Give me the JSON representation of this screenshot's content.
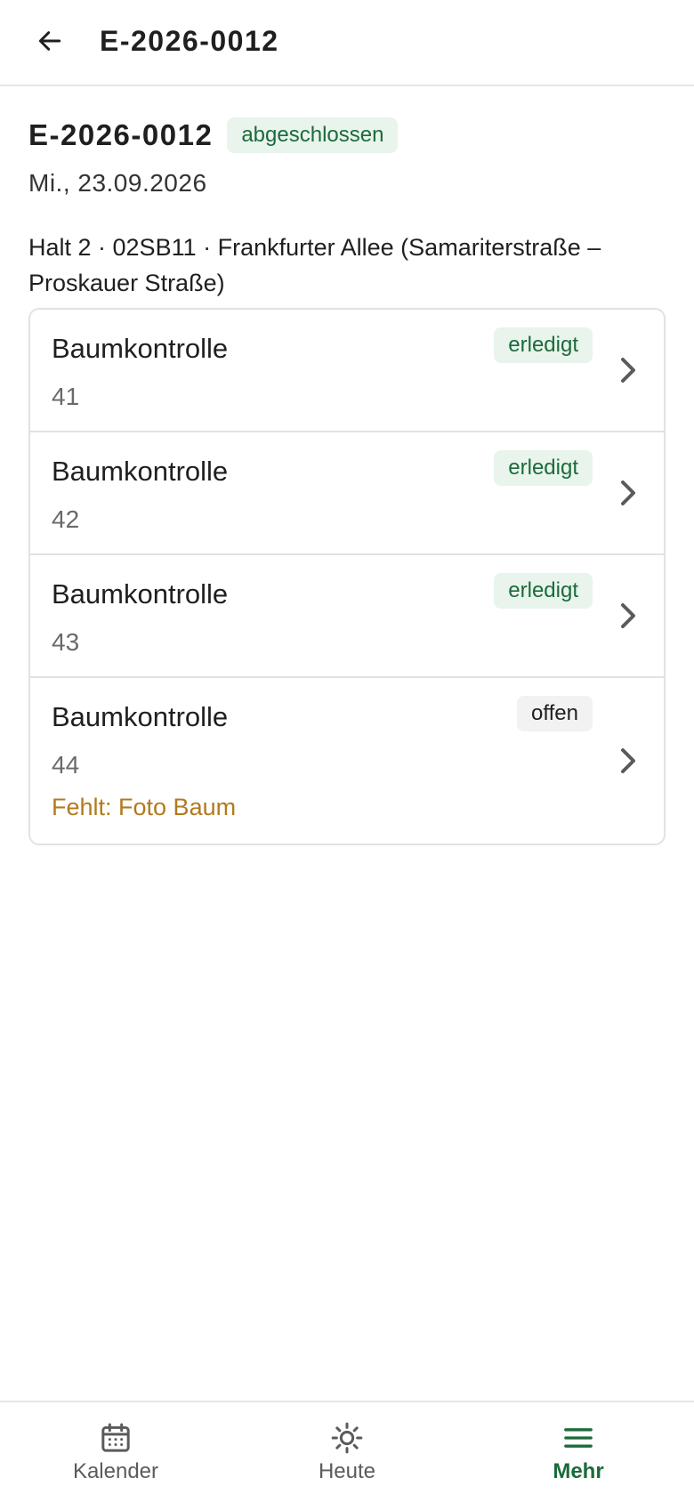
{
  "header": {
    "title": "E-2026-0012",
    "back_icon": "arrow-left-icon"
  },
  "order": {
    "number": "E-2026-0012",
    "status": "abgeschlossen",
    "date": "Mi., 23.09.2026",
    "stop": "Halt 2 · 02SB11 · Frankfurter Allee (Samariterstraße – Proskauer Straße)"
  },
  "tasks": [
    {
      "title": "Baumkontrolle",
      "number": "41",
      "status": "erledigt",
      "missing": ""
    },
    {
      "title": "Baumkontrolle",
      "number": "42",
      "status": "erledigt",
      "missing": ""
    },
    {
      "title": "Baumkontrolle",
      "number": "43",
      "status": "erledigt",
      "missing": ""
    },
    {
      "title": "Baumkontrolle",
      "number": "44",
      "status": "offen",
      "missing": "Fehlt: Foto Baum"
    }
  ],
  "nav": {
    "items": [
      {
        "label": "Kalender",
        "icon": "calendar-icon"
      },
      {
        "label": "Heute",
        "icon": "sun-icon"
      },
      {
        "label": "Mehr",
        "icon": "menu-icon"
      }
    ],
    "active": "Mehr"
  },
  "colors": {
    "accent": "#1c6b3a",
    "badge_green_bg": "#e8f4ec",
    "warning_text": "#b27a1d"
  }
}
